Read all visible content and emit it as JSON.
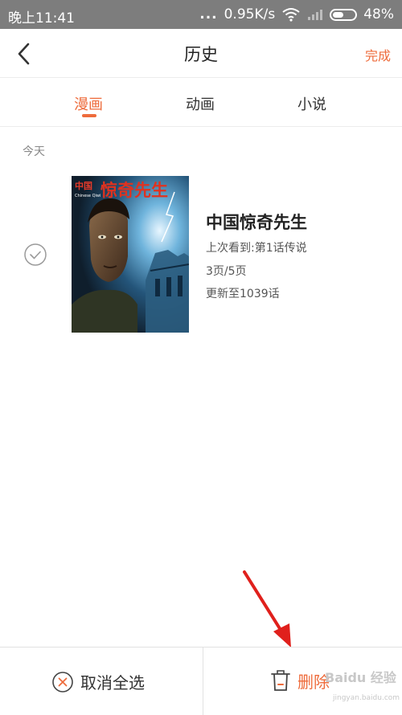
{
  "status_bar": {
    "time": "晚上11:41",
    "network_speed": "0.95K/s",
    "battery": "48%",
    "dots": "..."
  },
  "header": {
    "title": "历史",
    "done_label": "完成"
  },
  "tabs": [
    {
      "label": "漫画",
      "active": true
    },
    {
      "label": "动画",
      "active": false
    },
    {
      "label": "小说",
      "active": false
    }
  ],
  "section_label": "今天",
  "item": {
    "title": "中国惊奇先生",
    "last_read": "上次看到:第1话传说",
    "pages": "3页/5页",
    "updated": "更新至1039话",
    "cover_brand": "中国",
    "cover_sub": "Chinese Qiwi",
    "cover_title": "惊奇先生"
  },
  "bottom_bar": {
    "cancel_label": "取消全选",
    "delete_label": "删除"
  },
  "watermark": {
    "brand": "Baidu 经验",
    "url": "jingyan.baidu.com"
  },
  "colors": {
    "accent": "#ee6b3b",
    "status_bar": "#7d7d7d",
    "annotation_arrow": "#e0201c"
  },
  "icons": {
    "back": "chevron-left-icon",
    "check": "check-circle-icon",
    "cancel": "close-circle-icon",
    "delete": "trash-icon",
    "wifi": "wifi-icon",
    "signal": "signal-icon",
    "battery": "battery-icon"
  }
}
